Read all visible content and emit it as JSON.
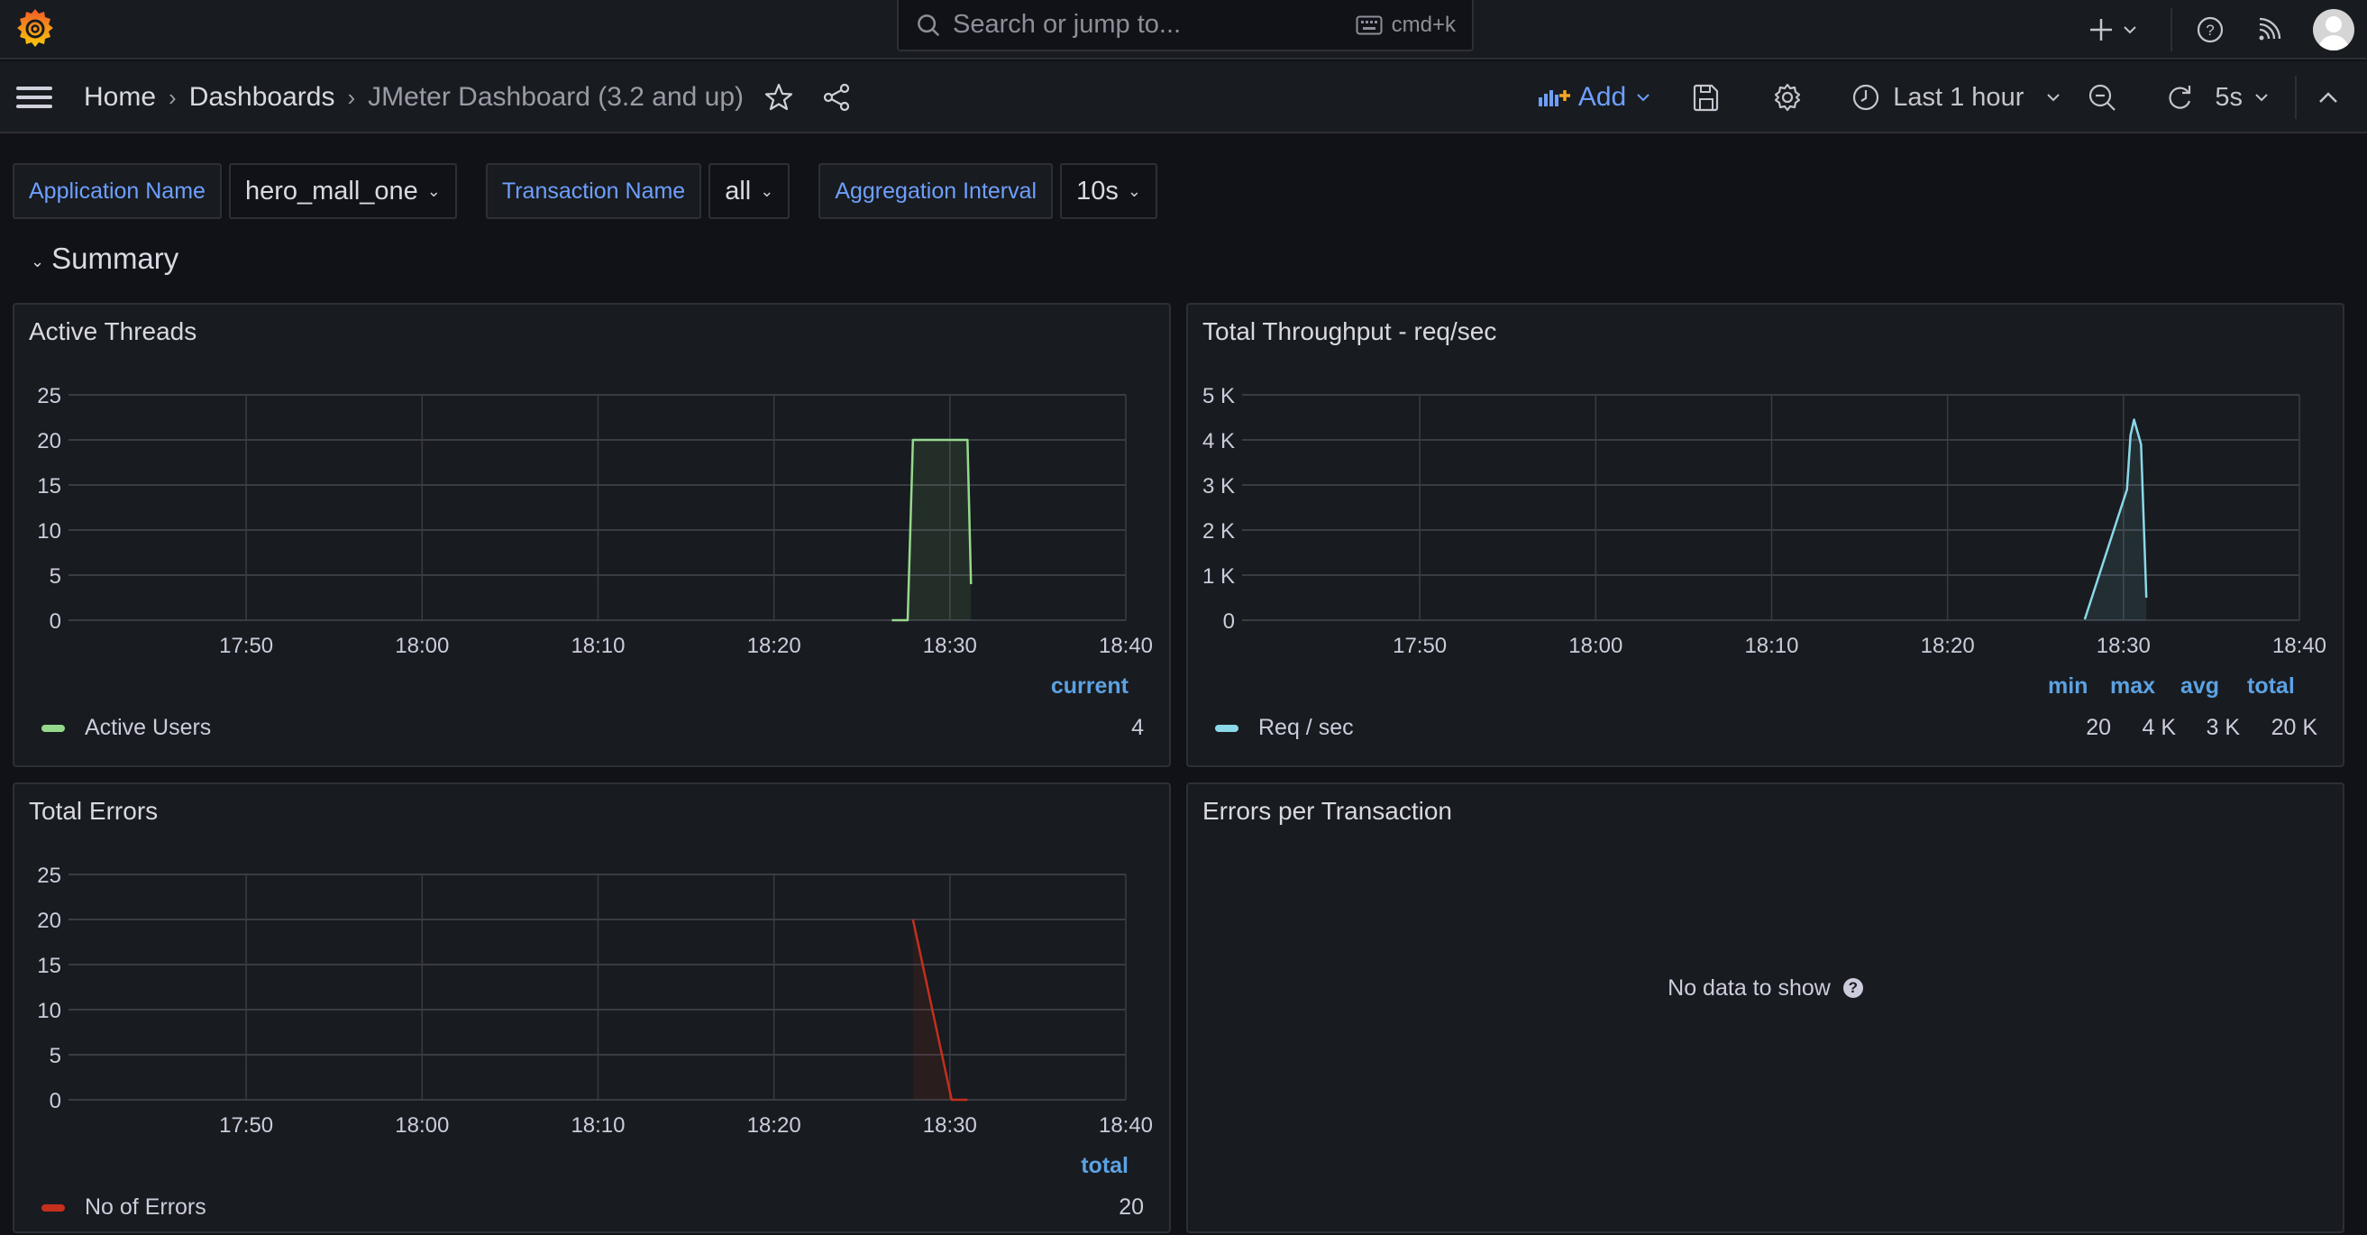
{
  "topbar": {
    "search_placeholder": "Search or jump to...",
    "search_shortcut": "cmd+k",
    "icons": [
      "grafana-logo-icon",
      "search-icon",
      "keyboard-icon",
      "plus-icon",
      "chevron-down-icon",
      "help-icon",
      "news-rss-icon",
      "user-avatar"
    ]
  },
  "breadcrumb": {
    "items": [
      "Home",
      "Dashboards",
      "JMeter Dashboard (3.2 and up)"
    ]
  },
  "toolbar": {
    "add_label": "Add",
    "time_range": "Last 1 hour",
    "refresh_interval": "5s"
  },
  "variables": [
    {
      "label": "Application Name",
      "value": "hero_mall_one"
    },
    {
      "label": "Transaction Name",
      "value": "all"
    },
    {
      "label": "Aggregation Interval",
      "value": "10s"
    }
  ],
  "row": {
    "title": "Summary"
  },
  "colors": {
    "accent": "#6e9fff",
    "legend_header": "#5ca2e3",
    "active_users": "#96d98d",
    "req_sec": "#8ad8e8",
    "errors": "#c4301d"
  },
  "panels": {
    "errors_per_transaction": {
      "title": "Errors per Transaction",
      "no_data": "No data to show"
    }
  },
  "chart_data": [
    {
      "id": "active_threads",
      "type": "line",
      "title": "Active Threads",
      "xlabel": "",
      "ylabel": "",
      "x_ticks": [
        "17:50",
        "18:00",
        "18:10",
        "18:20",
        "18:30",
        "18:40"
      ],
      "x_range_minutes": [
        -10.1,
        50
      ],
      "y_ticks": [
        "0",
        "5",
        "10",
        "15",
        "20",
        "25"
      ],
      "ylim": [
        0,
        25
      ],
      "grid": true,
      "legend_position": "bottom",
      "legend_columns": [
        "current"
      ],
      "series": [
        {
          "name": "Active Users",
          "color": "#96d98d",
          "x_minutes_after_1750": [
            36.7,
            37.6,
            37.9,
            41.0,
            41.2
          ],
          "values": [
            0,
            0,
            20,
            20,
            4
          ],
          "stats": [
            "4"
          ]
        }
      ]
    },
    {
      "id": "total_throughput",
      "type": "area",
      "title": "Total Throughput - req/sec",
      "xlabel": "",
      "ylabel": "",
      "x_ticks": [
        "17:50",
        "18:00",
        "18:10",
        "18:20",
        "18:30",
        "18:40"
      ],
      "x_range_minutes": [
        -10.1,
        50
      ],
      "y_ticks": [
        "0",
        "1 K",
        "2 K",
        "3 K",
        "4 K",
        "5 K"
      ],
      "ylim": [
        0,
        5000
      ],
      "grid": true,
      "legend_position": "bottom",
      "legend_columns": [
        "min",
        "max",
        "avg",
        "total"
      ],
      "series": [
        {
          "name": "Req / sec",
          "color": "#8ad8e8",
          "x_minutes_after_1750": [
            37.8,
            40.2,
            40.4,
            40.6,
            41.0,
            41.3
          ],
          "values": [
            20,
            2900,
            4100,
            4450,
            3900,
            500
          ],
          "stats": [
            "20",
            "4 K",
            "3 K",
            "20 K"
          ]
        }
      ]
    },
    {
      "id": "total_errors",
      "type": "line",
      "title": "Total Errors",
      "xlabel": "",
      "ylabel": "",
      "x_ticks": [
        "17:50",
        "18:00",
        "18:10",
        "18:20",
        "18:30",
        "18:40"
      ],
      "x_range_minutes": [
        -10.1,
        50
      ],
      "y_ticks": [
        "0",
        "5",
        "10",
        "15",
        "20",
        "25"
      ],
      "ylim": [
        0,
        25
      ],
      "grid": true,
      "legend_position": "bottom",
      "legend_columns": [
        "total"
      ],
      "series": [
        {
          "name": "No of Errors",
          "color": "#c4301d",
          "x_minutes_after_1750": [
            37.9,
            40.1,
            41.0
          ],
          "values": [
            20,
            0,
            0
          ],
          "stats": [
            "20"
          ]
        }
      ]
    }
  ]
}
